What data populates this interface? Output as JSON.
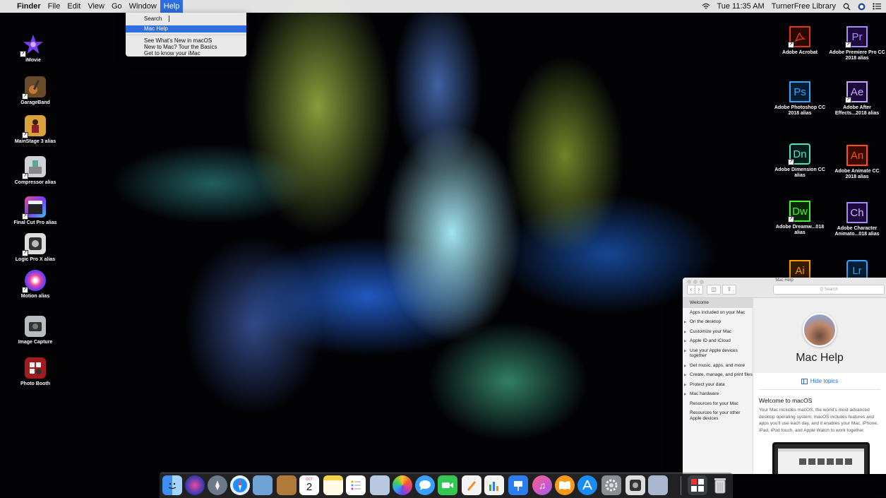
{
  "menubar": {
    "apple": "",
    "app_name": "Finder",
    "menus": [
      "File",
      "Edit",
      "View",
      "Go",
      "Window",
      "Help"
    ],
    "clock": "Tue 11:35 AM",
    "user": "TurnerFree Library"
  },
  "help_menu": {
    "search_label": "Search",
    "items": [
      "Mac Help",
      "See What's New in macOS",
      "New to Mac? Tour the Basics",
      "Get to know your iMac"
    ]
  },
  "desktop_left": [
    {
      "label": "iMovie",
      "icon": "star-icon"
    },
    {
      "label": "GarageBand",
      "icon": "guitar-icon"
    },
    {
      "label": "MainStage 3 alias",
      "icon": "performer-icon"
    },
    {
      "label": "Compressor alias",
      "icon": "compressor-icon"
    },
    {
      "label": "Final Cut Pro alias",
      "icon": "clapperboard-icon"
    },
    {
      "label": "Logic Pro X alias",
      "icon": "logic-icon"
    },
    {
      "label": "Motion alias",
      "icon": "motion-icon"
    },
    {
      "label": "Image Capture",
      "icon": "camera-icon"
    },
    {
      "label": "Photo Booth",
      "icon": "photobooth-icon"
    }
  ],
  "desktop_right": [
    {
      "label": "Adobe Acrobat",
      "abbr": "",
      "color": "#e0341c"
    },
    {
      "label": "Adobe Premiere Pro CC 2018 alias",
      "abbr": "Pr",
      "color": "#a58cf5"
    },
    {
      "label": "Adobe Photoshop CC 2018 alias",
      "abbr": "Ps",
      "color": "#31a8ff"
    },
    {
      "label": "Adobe After Effects...2018 alias",
      "abbr": "Ae",
      "color": "#c8a6ff"
    },
    {
      "label": "Adobe Dimension CC alias",
      "abbr": "Dn",
      "color": "#52e2c4"
    },
    {
      "label": "Adobe Animate CC 2018 alias",
      "abbr": "An",
      "color": "#ff4c1a"
    },
    {
      "label": "Adobe Dreamw...018 alias",
      "abbr": "Dw",
      "color": "#4af037"
    },
    {
      "label": "Adobe Character Animato...018 alias",
      "abbr": "Ch",
      "color": "#a58cf5"
    },
    {
      "label": "",
      "abbr": "Ai",
      "color": "#ff9a00"
    },
    {
      "label": "",
      "abbr": "Lr",
      "color": "#31a8ff"
    }
  ],
  "help_window": {
    "title": "Mac Help",
    "search_placeholder": "Q Search",
    "sidebar": [
      {
        "label": "Welcome",
        "arrow": false,
        "selected": true
      },
      {
        "label": "Apps included on your Mac",
        "arrow": false,
        "selected": false
      },
      {
        "label": "On the desktop",
        "arrow": true,
        "selected": false
      },
      {
        "label": "Customize your Mac",
        "arrow": true,
        "selected": false
      },
      {
        "label": "Apple ID and iCloud",
        "arrow": true,
        "selected": false
      },
      {
        "label": "Use your Apple devices together",
        "arrow": true,
        "selected": false
      },
      {
        "label": "Get music, apps, and more",
        "arrow": true,
        "selected": false
      },
      {
        "label": "Create, manage, and print files",
        "arrow": true,
        "selected": false
      },
      {
        "label": "Protect your data",
        "arrow": true,
        "selected": false
      },
      {
        "label": "Mac hardware",
        "arrow": true,
        "selected": false
      },
      {
        "label": "Resources for your Mac",
        "arrow": false,
        "selected": false
      },
      {
        "label": "Resources for your other Apple devices",
        "arrow": false,
        "selected": false
      }
    ],
    "big_title": "Mac Help",
    "hide_topics": "Hide topics",
    "heading": "Welcome to macOS",
    "body": "Your Mac includes macOS, the world's most advanced desktop operating system. macOS includes features and apps you'll use each day, and it enables your Mac, iPhone, iPad, iPod touch, and Apple Watch to work together."
  },
  "dock": {
    "calendar_month": "OCT",
    "calendar_day": "2",
    "items": [
      "finder-icon",
      "siri-icon",
      "launchpad-icon",
      "safari-icon",
      "preview-icon",
      "contacts-icon",
      "calendar-icon",
      "notes-icon",
      "reminders-icon",
      "photos-edit-icon",
      "photos-icon",
      "messages-icon",
      "facetime-icon",
      "pages-icon",
      "numbers-icon",
      "keynote-icon",
      "itunes-icon",
      "ibooks-icon",
      "app-store-icon",
      "system-preferences-icon",
      "logic-icon",
      "preview-scanner-icon",
      "font-book-icon",
      "trash-icon"
    ]
  },
  "colors": {
    "accent": "#2e6ede",
    "link": "#2a70d6"
  }
}
